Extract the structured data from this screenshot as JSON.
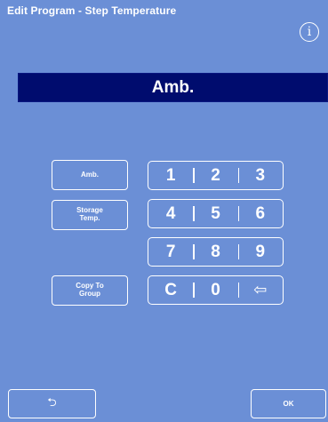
{
  "header": {
    "title": "Edit Program - Step Temperature",
    "info_icon": "i"
  },
  "display": {
    "value": "Amb."
  },
  "side_buttons": {
    "amb": "Amb.",
    "storage_line1": "Storage",
    "storage_line2": "Temp.",
    "copy_line1": "Copy To",
    "copy_line2": "Group"
  },
  "keypad": {
    "rows": [
      [
        "1",
        "2",
        "3"
      ],
      [
        "4",
        "5",
        "6"
      ],
      [
        "7",
        "8",
        "9"
      ],
      [
        "C",
        "0",
        "⇦"
      ]
    ]
  },
  "footer": {
    "back_icon": "⮌",
    "ok_label": "OK"
  }
}
